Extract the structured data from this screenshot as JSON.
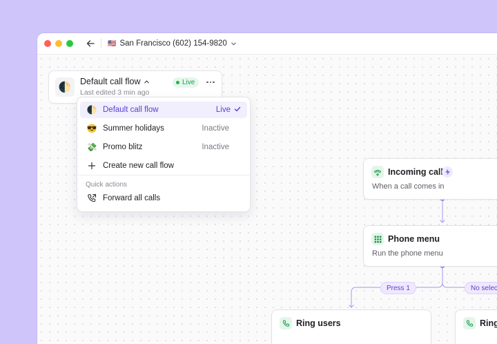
{
  "window": {
    "phone_line": {
      "flag": "🇺🇸",
      "label": "San Francisco (602) 154-9820"
    }
  },
  "flow_card": {
    "emoji": "🌓",
    "title": "Default call flow",
    "subtitle": "Last edited 3 min ago",
    "status": "Live"
  },
  "dropdown": {
    "items": [
      {
        "emoji": "🌓",
        "label": "Default call flow",
        "status": "Live",
        "selected": true
      },
      {
        "emoji": "😎",
        "label": "Summer holidays",
        "status": "Inactive",
        "selected": false
      },
      {
        "emoji": "💸",
        "label": "Promo blitz",
        "status": "Inactive",
        "selected": false
      }
    ],
    "create_label": "Create new call flow",
    "quick_actions_heading": "Quick actions",
    "forward_label": "Forward all calls"
  },
  "nodes": {
    "incoming": {
      "title": "Incoming call",
      "subtitle": "When a call comes in",
      "icon": "incoming-call-icon"
    },
    "phone_menu": {
      "title": "Phone menu",
      "subtitle": "Run the phone menu",
      "icon": "keypad-icon"
    },
    "ring_users": {
      "title": "Ring users",
      "icon": "phone-icon"
    },
    "ring_partial": {
      "title": "Ring",
      "icon": "phone-icon"
    }
  },
  "branches": {
    "press_1": "Press 1",
    "no_selection": "No selection"
  },
  "colors": {
    "background": "#cfc5fb",
    "accent": "#5a3fd0",
    "live_green": "#22b14c",
    "node_icon_bg": "#e4f5ea"
  }
}
